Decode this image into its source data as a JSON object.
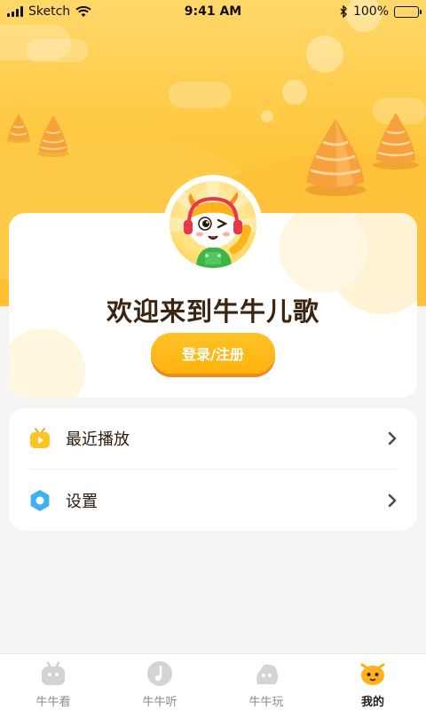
{
  "status_bar": {
    "carrier": "Sketch",
    "time": "9:41 AM",
    "battery": "100%"
  },
  "profile": {
    "welcome_text": "欢迎来到牛牛儿歌",
    "login_label": "登录/注册"
  },
  "menu": {
    "items": [
      {
        "label": "最近播放",
        "icon": "play-tv-icon"
      },
      {
        "label": "设置",
        "icon": "settings-hex-icon"
      }
    ]
  },
  "tabbar": {
    "tabs": [
      {
        "label": "牛牛看",
        "icon": "watch-icon",
        "active": false
      },
      {
        "label": "牛牛听",
        "icon": "listen-icon",
        "active": false
      },
      {
        "label": "牛牛玩",
        "icon": "play-icon",
        "active": false
      },
      {
        "label": "我的",
        "icon": "mine-icon",
        "active": true
      }
    ]
  },
  "colors": {
    "accent": "#ffb20d",
    "hero_top": "#ffd86a",
    "hero_bottom": "#ffbf2e",
    "text_dark": "#3b2412"
  }
}
